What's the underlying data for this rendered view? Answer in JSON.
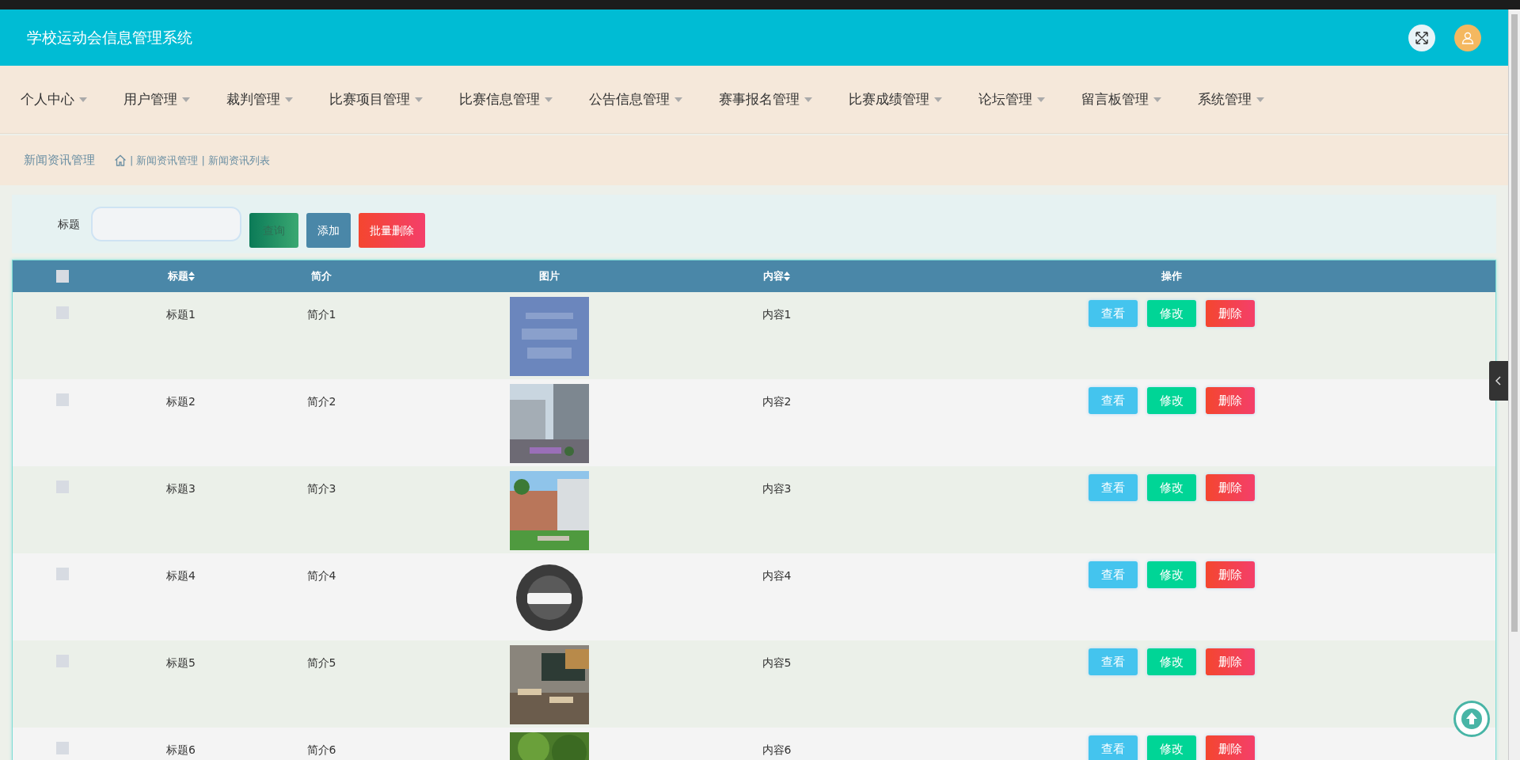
{
  "header": {
    "title": "学校运动会信息管理系统"
  },
  "nav": [
    {
      "label": "个人中心"
    },
    {
      "label": "用户管理"
    },
    {
      "label": "裁判管理"
    },
    {
      "label": "比赛项目管理"
    },
    {
      "label": "比赛信息管理"
    },
    {
      "label": "公告信息管理"
    },
    {
      "label": "赛事报名管理"
    },
    {
      "label": "比赛成绩管理"
    },
    {
      "label": "论坛管理"
    },
    {
      "label": "留言板管理"
    },
    {
      "label": "系统管理"
    }
  ],
  "breadcrumb": {
    "section": "新闻资讯管理",
    "items": [
      {
        "sep": "|",
        "label": "新闻资讯管理"
      },
      {
        "sep": "|",
        "label": "新闻资讯列表"
      }
    ]
  },
  "search": {
    "label": "标题",
    "buttons": [
      {
        "label": "查询",
        "kind": "search"
      },
      {
        "label": "添加",
        "kind": "add"
      },
      {
        "label": "批量删除",
        "kind": "batch-delete"
      }
    ]
  },
  "table": {
    "columns": [
      {
        "kind": "checkbox",
        "checked": false
      },
      {
        "kind": "text",
        "label": "标题",
        "sortable": true
      },
      {
        "kind": "text",
        "label": "简介",
        "sortable": false
      },
      {
        "kind": "picture",
        "label": "图片",
        "sortable": false
      },
      {
        "kind": "text",
        "label": "内容",
        "sortable": true
      },
      {
        "kind": "actions",
        "label": "操作",
        "sortable": false
      }
    ],
    "rows": [
      {
        "checked": false,
        "title": "标题1",
        "brief": "简介1",
        "content": "内容1",
        "actions": [
          {
            "label": "查看",
            "kind": "view"
          },
          {
            "label": "修改",
            "kind": "edit"
          },
          {
            "label": "删除",
            "kind": "delete"
          }
        ]
      },
      {
        "checked": false,
        "title": "标题2",
        "brief": "简介2",
        "content": "内容2",
        "actions": [
          {
            "label": "查看",
            "kind": "view"
          },
          {
            "label": "修改",
            "kind": "edit"
          },
          {
            "label": "删除",
            "kind": "delete"
          }
        ]
      },
      {
        "checked": false,
        "title": "标题3",
        "brief": "简介3",
        "content": "内容3",
        "actions": [
          {
            "label": "查看",
            "kind": "view"
          },
          {
            "label": "修改",
            "kind": "edit"
          },
          {
            "label": "删除",
            "kind": "delete"
          }
        ]
      },
      {
        "checked": false,
        "title": "标题4",
        "brief": "简介4",
        "content": "内容4",
        "actions": [
          {
            "label": "查看",
            "kind": "view"
          },
          {
            "label": "修改",
            "kind": "edit"
          },
          {
            "label": "删除",
            "kind": "delete"
          }
        ]
      },
      {
        "checked": false,
        "title": "标题5",
        "brief": "简介5",
        "content": "内容5",
        "actions": [
          {
            "label": "查看",
            "kind": "view"
          },
          {
            "label": "修改",
            "kind": "edit"
          },
          {
            "label": "删除",
            "kind": "delete"
          }
        ]
      },
      {
        "checked": false,
        "title": "标题6",
        "brief": "简介6",
        "content": "内容6",
        "actions": [
          {
            "label": "查看",
            "kind": "view"
          },
          {
            "label": "修改",
            "kind": "edit"
          },
          {
            "label": "删除",
            "kind": "delete"
          }
        ]
      }
    ]
  }
}
